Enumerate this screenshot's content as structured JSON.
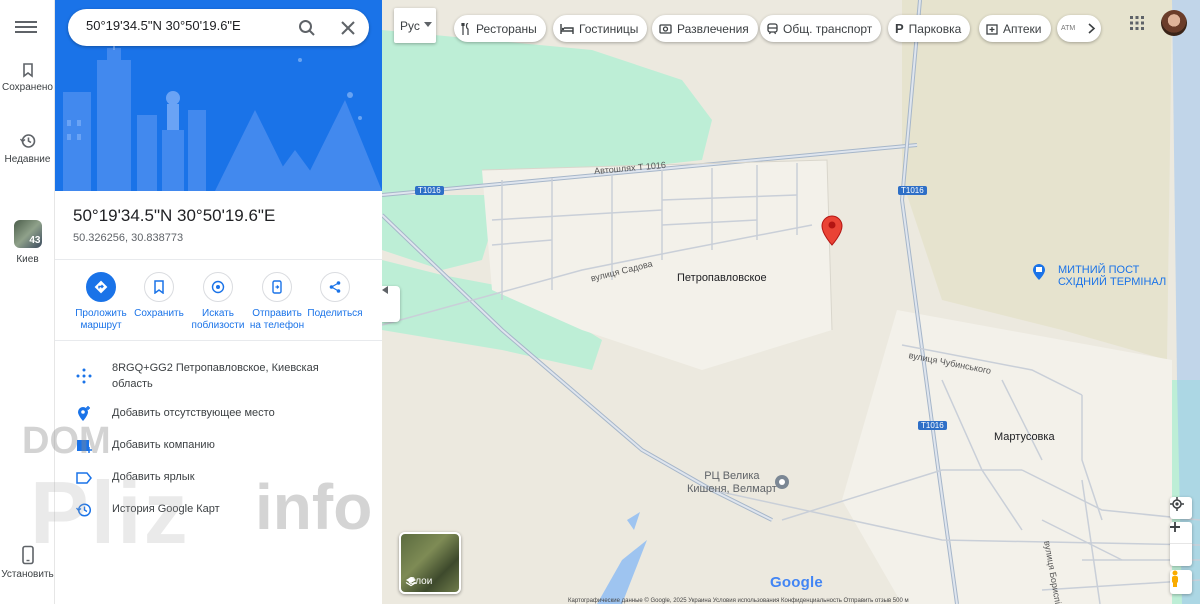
{
  "rail": {
    "saved_label": "Сохранено",
    "recent_label": "Недавние",
    "kyiv_label": "Киев",
    "kyiv_badge": "43",
    "install_label": "Установить"
  },
  "search": {
    "value": "50°19'34.5\"N 30°50'19.6\"E"
  },
  "place": {
    "title": "50°19'34.5\"N 30°50'19.6\"E",
    "decimal": "50.326256, 30.838773"
  },
  "actions": [
    {
      "label1": "Проложить",
      "label2": "маршрут"
    },
    {
      "label1": "Сохранить",
      "label2": ""
    },
    {
      "label1": "Искать",
      "label2": "поблизости"
    },
    {
      "label1": "Отправить",
      "label2": "на телефон"
    },
    {
      "label1": "Поделиться",
      "label2": ""
    }
  ],
  "info": {
    "pluscode_line1": "8RGQ+GG2 Петропавловское, Киевская",
    "pluscode_line2": "область",
    "add_missing": "Добавить отсутствующее место",
    "add_business": "Добавить компанию",
    "add_label": "Добавить ярлык",
    "history": "История Google Карт"
  },
  "map": {
    "lang_button": "Рус",
    "chips": [
      "Рестораны",
      "Гостиницы",
      "Развлечения",
      "Общ. транспорт",
      "Парковка",
      "Аптеки",
      "ATM"
    ],
    "labels": {
      "highway_name": "Автошлях Т 1016",
      "road_shield": "T1016",
      "street_sadova": "вулиця Садова",
      "village_1": "Петропавловское",
      "customs_1": "МИТНИЙ ПОСТ",
      "customs_2": "СХІДНИЙ ТЕРМІНАЛ",
      "street_chubynskoho": "вулиця Чубинського",
      "village_2": "Мартусовка",
      "mall_1": "РЦ Велика",
      "mall_2": "Кишеня, Велмарт",
      "street_boryspilska": "вулиця Бориспільська"
    },
    "layers_label": "Слои",
    "logo": "Google",
    "footer": "Картографические данные © Google, 2025   Украина   Условия использования   Конфиденциальность   Отправить отзыв   500 м"
  },
  "watermark": {
    "line1": "DOM",
    "line2": "Pliz",
    "line3": "info"
  },
  "colors": {
    "primary": "#1a73e8",
    "marker": "#ea4335",
    "green": "#bdeed6",
    "water": "#9ec4f0"
  }
}
